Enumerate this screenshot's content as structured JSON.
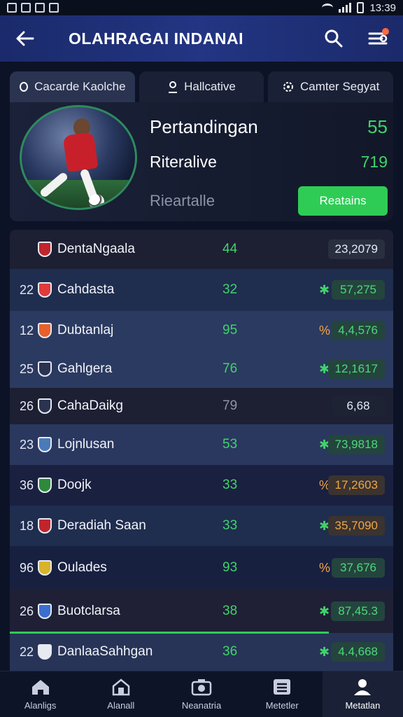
{
  "status_bar": {
    "time": "13:39"
  },
  "app_bar": {
    "title": "OLAHRAGAI INDANAI"
  },
  "tabs": [
    {
      "label": "Cacarde Kaolche",
      "icon": "circle-icon"
    },
    {
      "label": "Hallcative",
      "icon": "person-icon"
    },
    {
      "label": "Camter Segyat",
      "icon": "gear-icon"
    }
  ],
  "hero": {
    "row1": {
      "label": "Pertandingan",
      "value": "55"
    },
    "row2": {
      "label": "Riteralive",
      "value": "719"
    },
    "row3": {
      "label": "Rieartalle",
      "button": "Reatains"
    }
  },
  "table": {
    "rows": [
      {
        "rank": "",
        "crest_color": "#c0252d",
        "team": "DentaNgaala",
        "points": "44",
        "trend": "",
        "pill": "23,2079",
        "pill_style": "grey"
      },
      {
        "rank": "22",
        "crest_color": "#e03a3a",
        "team": "Cahdasta",
        "points": "32",
        "trend": "✱",
        "pill": "57,275",
        "pill_style": "green"
      },
      {
        "rank": "12",
        "crest_color": "#e8602a",
        "team": "Dubtanlaj",
        "points": "95",
        "trend": "%",
        "pill": "4,4,576",
        "pill_style": "green"
      },
      {
        "rank": "25",
        "crest_color": "#2a3350",
        "team": "Gahlgera",
        "points": "76",
        "trend": "✱",
        "pill": "12,1617",
        "pill_style": "green"
      },
      {
        "rank": "26",
        "crest_color": "#2a3350",
        "team": "CahaDaikg",
        "points": "79",
        "trend": "",
        "pill": "6,68",
        "pill_style": "dark"
      },
      {
        "rank": "23",
        "crest_color": "#4a7bb8",
        "team": "Lojnlusan",
        "points": "53",
        "trend": "✱",
        "pill": "73,9818",
        "pill_style": "green"
      },
      {
        "rank": "36",
        "crest_color": "#2c8a3a",
        "team": "Doojk",
        "points": "33",
        "trend": "%",
        "pill": "17,2603",
        "pill_style": "orange"
      },
      {
        "rank": "18",
        "crest_color": "#c0252d",
        "team": "Deradiah Saan",
        "points": "33",
        "trend": "✱",
        "pill": "35,7090",
        "pill_style": "orange"
      },
      {
        "rank": "96",
        "crest_color": "#d9b32a",
        "team": "Oulades",
        "points": "93",
        "trend": "%",
        "pill": "37,676",
        "pill_style": "green"
      },
      {
        "rank": "26",
        "crest_color": "#3a6fd0",
        "team": "Buotclarsa",
        "points": "38",
        "trend": "✱",
        "pill": "87,45.3",
        "pill_style": "green"
      },
      {
        "rank": "22",
        "crest_color": "#e8eaf2",
        "team": "DanlaaSahhgan",
        "points": "36",
        "trend": "✱",
        "pill": "4.4,668",
        "pill_style": "green"
      }
    ]
  },
  "bottom_nav": [
    {
      "label": "Alanligs",
      "icon": "home-icon"
    },
    {
      "label": "Alanall",
      "icon": "stadium-icon"
    },
    {
      "label": "Neanatria",
      "icon": "camera-icon"
    },
    {
      "label": "Metetler",
      "icon": "list-icon"
    },
    {
      "label": "Metatlan",
      "icon": "profile-icon"
    }
  ],
  "colors": {
    "accent_green": "#41d36a",
    "app_bar": "#233583",
    "background": "#0d1326"
  }
}
